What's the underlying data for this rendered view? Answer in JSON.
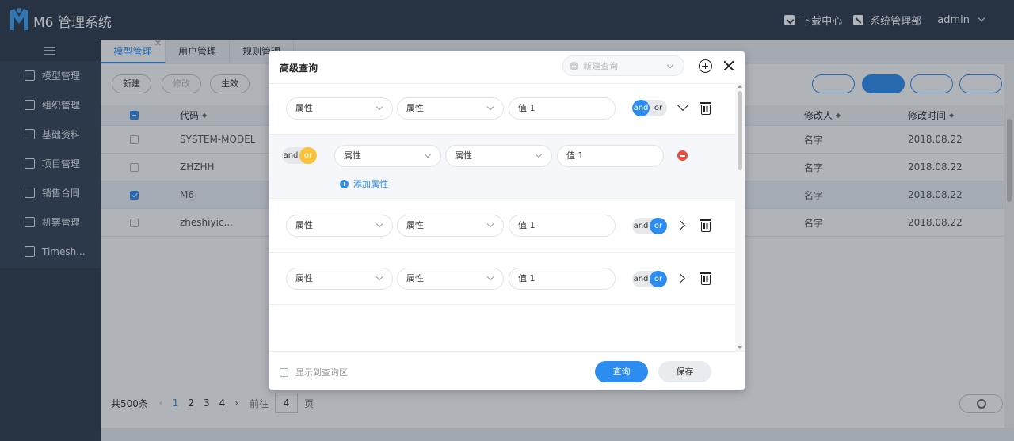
{
  "app": {
    "title": "M6 管理系统"
  },
  "topbar": {
    "download_label": "下载中心",
    "dept_label": "系统管理部",
    "user": "admin"
  },
  "sidebar": {
    "items": [
      {
        "label": "模型管理",
        "icon": "model-icon"
      },
      {
        "label": "组织管理",
        "icon": "org-icon"
      },
      {
        "label": "基础资料",
        "icon": "data-icon"
      },
      {
        "label": "项目管理",
        "icon": "layers-icon"
      },
      {
        "label": "销售合同",
        "icon": "contract-icon"
      },
      {
        "label": "机票管理",
        "icon": "plane-icon"
      },
      {
        "label": "Timesh...",
        "icon": "box-icon"
      }
    ]
  },
  "tabs": [
    {
      "label": "模型管理",
      "active": true
    },
    {
      "label": "用户管理",
      "active": false
    },
    {
      "label": "规则管理",
      "active": false
    }
  ],
  "toolbar": {
    "new_label": "新建",
    "edit_label": "修改",
    "effect_label": "生效"
  },
  "table": {
    "columns": {
      "code": "代码",
      "modifier": "修改人",
      "modified_time": "修改时间"
    },
    "rows": [
      {
        "code": "SYSTEM-MODEL",
        "modifier": "名字",
        "time": "2018.08.22",
        "checked": false
      },
      {
        "code": "ZHZHH",
        "modifier": "名字",
        "time": "2018.08.22",
        "checked": false
      },
      {
        "code": "M6",
        "modifier": "名字",
        "time": "2018.08.22",
        "checked": true
      },
      {
        "code": "zheshiyic...",
        "modifier": "名字",
        "time": "2018.08.22",
        "checked": false
      }
    ]
  },
  "pager": {
    "total": "共500条",
    "pages": [
      "1",
      "2",
      "3",
      "4"
    ],
    "current": "1",
    "goto_prefix": "前往",
    "goto_value": "4",
    "goto_suffix": "页"
  },
  "modal": {
    "title": "高级查询",
    "saved_query_placeholder": "新建查询",
    "add_attribute_label": "添加属性",
    "show_in_query_area": "显示到查询区",
    "query_button": "查询",
    "save_button": "保存",
    "rules": [
      {
        "field1": "属性",
        "field2": "属性",
        "value": "值 1",
        "and": "and",
        "or": "or",
        "selected": "and",
        "expand": "down"
      },
      {
        "field1": "属性",
        "field2": "属性",
        "value": "值 1",
        "and": "and",
        "or": "or",
        "selected": "or"
      },
      {
        "field1": "属性",
        "field2": "属性",
        "value": "值 1",
        "and": "and",
        "or": "or",
        "selected": "or",
        "expand": "right"
      },
      {
        "field1": "属性",
        "field2": "属性",
        "value": "值 1",
        "and": "and",
        "or": "or",
        "selected": "or",
        "expand": "right"
      }
    ]
  },
  "colors": {
    "primary": "#2d8cf0",
    "sidebar": "#2d3a4b",
    "danger": "#ed4d3c",
    "or_yellow": "#f8c23a"
  }
}
